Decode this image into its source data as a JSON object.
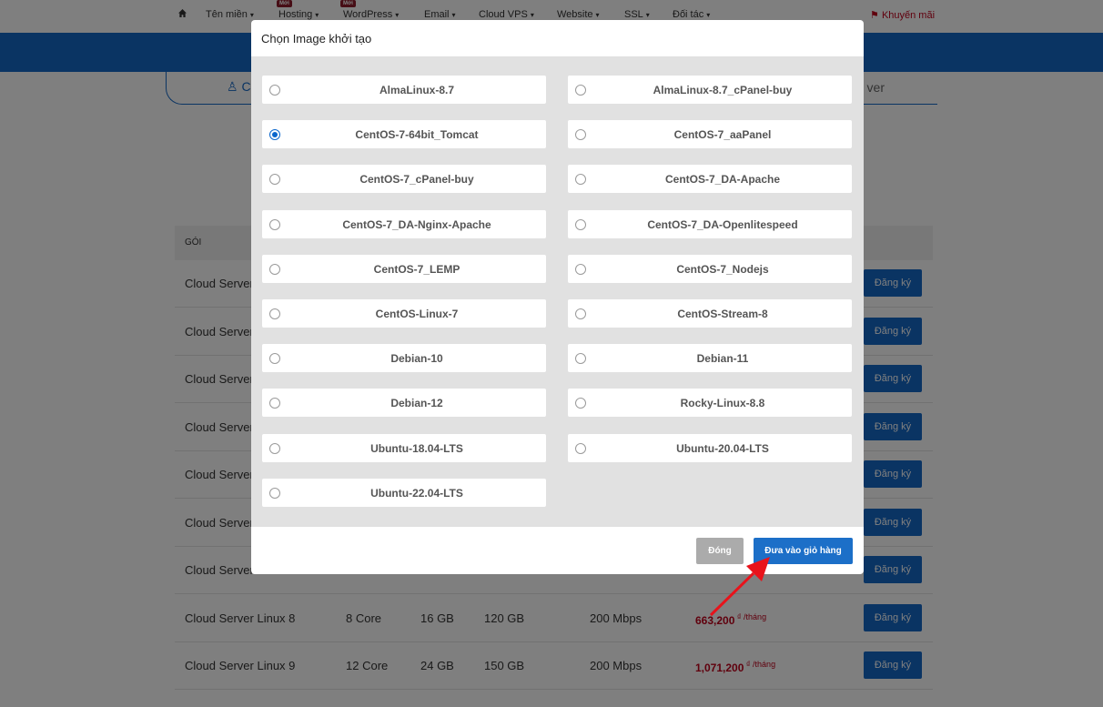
{
  "topnav": {
    "home_icon": "home-icon",
    "items": [
      "Tên miền",
      "Hosting",
      "WordPress",
      "Email",
      "Cloud VPS",
      "Website",
      "SSL",
      "Đối tác"
    ],
    "badge": "Mới",
    "promo": "Khuyến mãi",
    "promo_icon": "megaphone-icon"
  },
  "tabs": {
    "left": "C",
    "right": "ver"
  },
  "table": {
    "header_goi": "GÓI",
    "register_label": "Đăng ký",
    "rows": [
      {
        "name": "Cloud Server"
      },
      {
        "name": "Cloud Server"
      },
      {
        "name": "Cloud Server"
      },
      {
        "name": "Cloud Server"
      },
      {
        "name": "Cloud Server"
      },
      {
        "name": "Cloud Server"
      },
      {
        "name": "Cloud Server"
      },
      {
        "name": "Cloud Server Linux 8",
        "cpu": "8 Core",
        "ram": "16 GB",
        "disk": "120 GB",
        "bandwidth": "200 Mbps",
        "price": "663,200",
        "currency": "₫",
        "per": "/tháng"
      },
      {
        "name": "Cloud Server Linux 9",
        "cpu": "12 Core",
        "ram": "24 GB",
        "disk": "150 GB",
        "bandwidth": "200 Mbps",
        "price": "1,071,200",
        "currency": "₫",
        "per": "/tháng"
      }
    ]
  },
  "modal": {
    "title": "Chọn Image khởi tạo",
    "selected": "CentOS-7-64bit_Tomcat",
    "options": [
      "AlmaLinux-8.7",
      "AlmaLinux-8.7_cPanel-buy",
      "CentOS-7-64bit_Tomcat",
      "CentOS-7_aaPanel",
      "CentOS-7_cPanel-buy",
      "CentOS-7_DA-Apache",
      "CentOS-7_DA-Nginx-Apache",
      "CentOS-7_DA-Openlitespeed",
      "CentOS-7_LEMP",
      "CentOS-7_Nodejs",
      "CentOS-Linux-7",
      "CentOS-Stream-8",
      "Debian-10",
      "Debian-11",
      "Debian-12",
      "Rocky-Linux-8.8",
      "Ubuntu-18.04-LTS",
      "Ubuntu-20.04-LTS",
      "Ubuntu-22.04-LTS"
    ],
    "close_label": "Đóng",
    "cart_label": "Đưa vào giỏ hàng"
  },
  "colors": {
    "primary": "#1568c6",
    "price": "#c0001b",
    "arrow": "#e8131b"
  }
}
